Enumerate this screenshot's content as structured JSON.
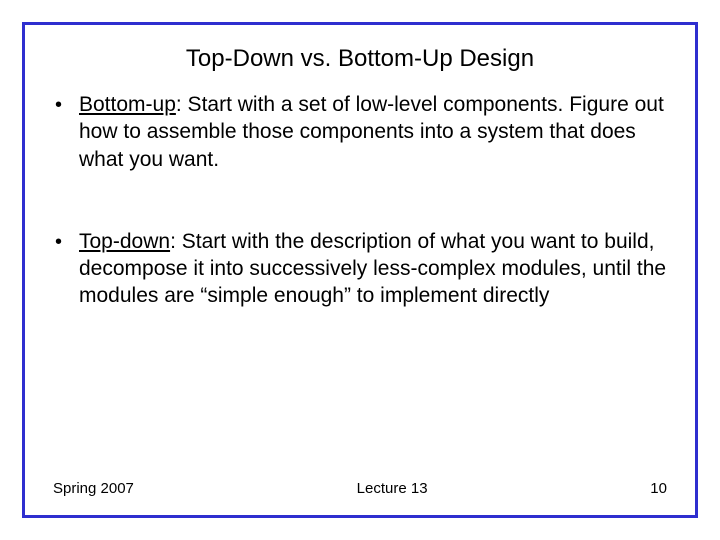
{
  "title": "Top-Down vs. Bottom-Up Design",
  "bullets": [
    {
      "term": "Bottom-up",
      "rest": ":  Start with a set of low-level components. Figure out how to assemble those components into a system that does what you want."
    },
    {
      "term": "Top-down",
      "rest": ": Start with the description of what you want to build, decompose it into successively less-complex modules, until the modules are “simple enough” to implement directly"
    }
  ],
  "footer": {
    "left": "Spring 2007",
    "center": "Lecture 13",
    "right": "10"
  }
}
